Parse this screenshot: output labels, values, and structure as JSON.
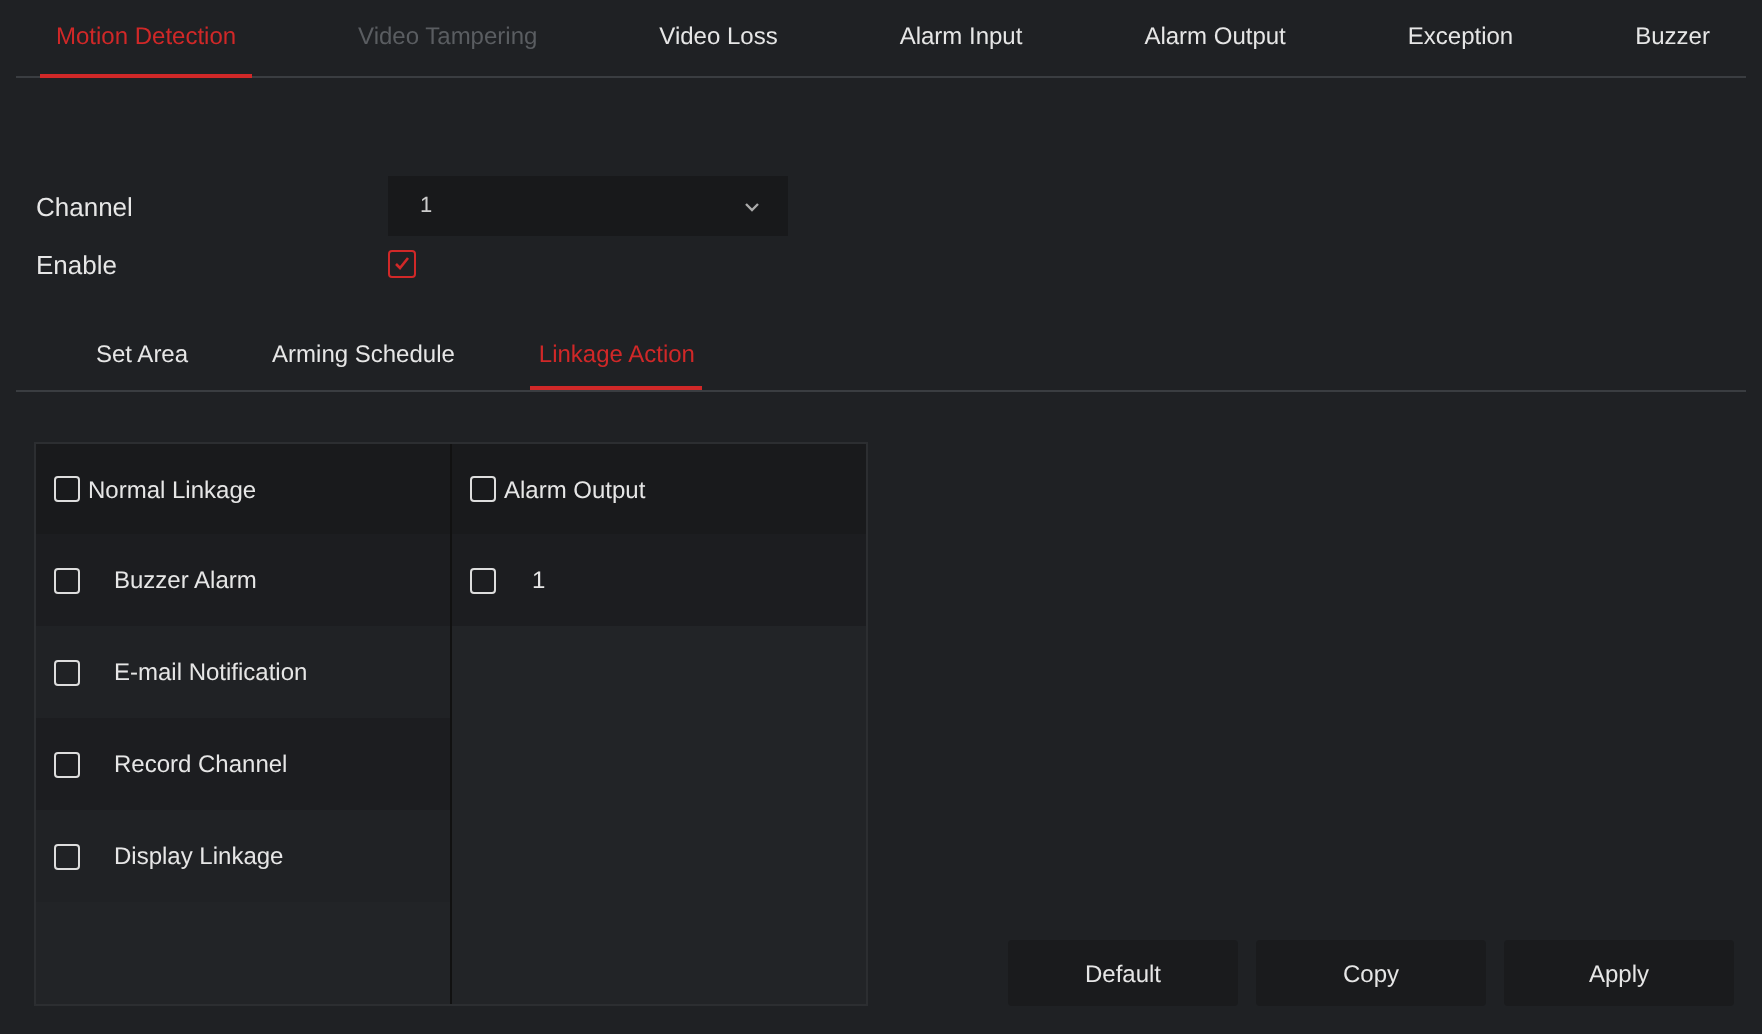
{
  "tabs": [
    {
      "label": "Motion Detection",
      "selected": true,
      "disabled": false
    },
    {
      "label": "Video Tampering",
      "selected": false,
      "disabled": true
    },
    {
      "label": "Video Loss",
      "selected": false,
      "disabled": false
    },
    {
      "label": "Alarm Input",
      "selected": false,
      "disabled": false
    },
    {
      "label": "Alarm Output",
      "selected": false,
      "disabled": false
    },
    {
      "label": "Exception",
      "selected": false,
      "disabled": false
    },
    {
      "label": "Buzzer",
      "selected": false,
      "disabled": false
    }
  ],
  "channel": {
    "label": "Channel",
    "value": "1"
  },
  "enable": {
    "label": "Enable",
    "checked": true
  },
  "subtabs": [
    {
      "label": "Set Area",
      "selected": false
    },
    {
      "label": "Arming Schedule",
      "selected": false
    },
    {
      "label": "Linkage Action",
      "selected": true
    }
  ],
  "normal_linkage": {
    "label": "Normal Linkage",
    "checked": false,
    "items": [
      {
        "label": "Buzzer Alarm",
        "checked": false
      },
      {
        "label": "E-mail Notification",
        "checked": false
      },
      {
        "label": "Record Channel",
        "checked": false
      },
      {
        "label": "Display Linkage",
        "checked": false
      }
    ]
  },
  "alarm_output": {
    "label": "Alarm Output",
    "checked": false,
    "items": [
      {
        "label": "1",
        "checked": false
      }
    ]
  },
  "buttons": [
    "Default",
    "Copy",
    "Apply"
  ]
}
